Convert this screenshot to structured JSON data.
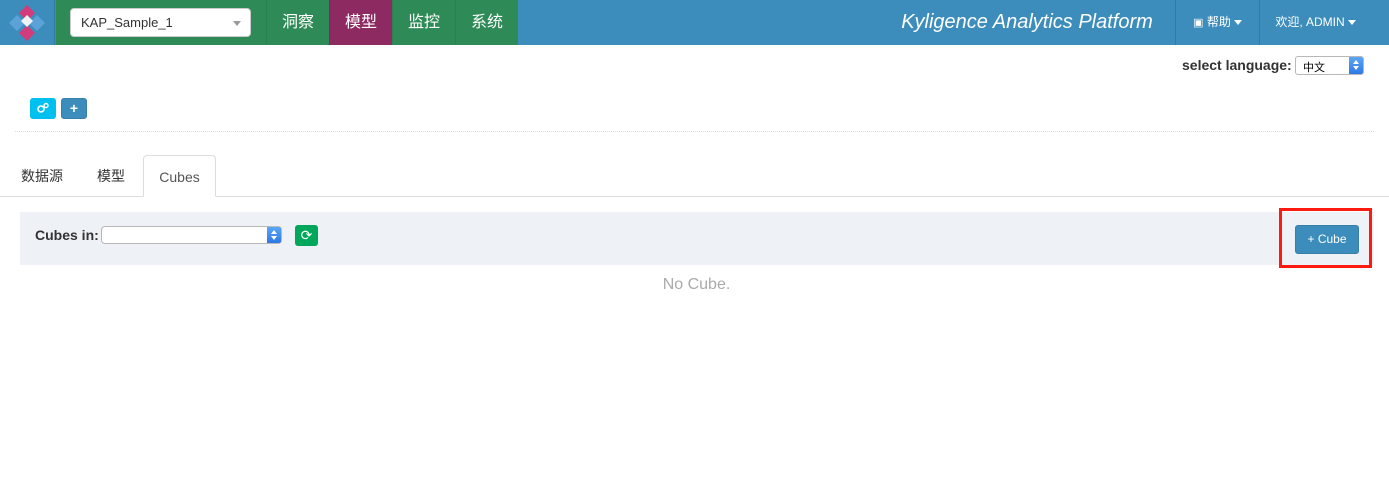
{
  "header": {
    "project": "KAP_Sample_1",
    "nav": [
      "洞察",
      "模型",
      "监控",
      "系统"
    ],
    "active_nav": "模型",
    "brand": "Kyligence Analytics Platform",
    "help_label": "帮助",
    "user_label": "欢迎, ADMIN"
  },
  "language": {
    "label": "select language:",
    "value": "中文"
  },
  "tabs": [
    "数据源",
    "模型",
    "Cubes"
  ],
  "active_tab": "Cubes",
  "cubes": {
    "label": "Cubes in:",
    "select_value": "",
    "add_label": "+ Cube",
    "empty_message": "No Cube."
  },
  "colors": {
    "header": "#3c8dbc",
    "nav_green": "#2e8b57",
    "nav_active": "#8e2a62",
    "highlight": "#ff1a0f"
  },
  "icons": {
    "logo": "cube-diamond-icon",
    "help": "book-icon",
    "refresh": "refresh-icon",
    "settings": "gears-icon",
    "add": "plus-icon"
  }
}
